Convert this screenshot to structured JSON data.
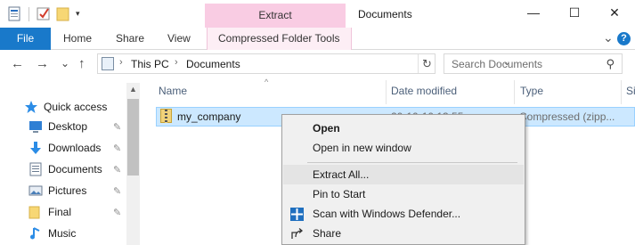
{
  "window": {
    "title": "Documents",
    "context_tab": "Extract",
    "controls": {
      "minimize": "—",
      "maximize": "☐",
      "close": "✕"
    }
  },
  "ribbon": {
    "file": "File",
    "tabs": [
      "Home",
      "Share",
      "View"
    ],
    "context_tab": "Compressed Folder Tools",
    "collapse_glyph": "⌄",
    "help_glyph": "?"
  },
  "nav": {
    "back": "←",
    "forward": "→",
    "recent": "⌄",
    "up": "↑",
    "breadcrumb": [
      "This PC",
      "Documents"
    ],
    "separator": "›",
    "dropdown": "⌄",
    "refresh": "↻",
    "search_placeholder": "Search Documents",
    "search_glyph": "⚲"
  },
  "sidebar": {
    "items": [
      {
        "label": "Quick access",
        "icon": "star-icon",
        "pinned": false
      },
      {
        "label": "Desktop",
        "icon": "desktop-icon",
        "pinned": true
      },
      {
        "label": "Downloads",
        "icon": "download-icon",
        "pinned": true
      },
      {
        "label": "Documents",
        "icon": "document-icon",
        "pinned": true
      },
      {
        "label": "Pictures",
        "icon": "pictures-icon",
        "pinned": true
      },
      {
        "label": "Final",
        "icon": "folder-icon",
        "pinned": true
      },
      {
        "label": "Music",
        "icon": "music-icon",
        "pinned": false
      }
    ],
    "pin_glyph": "📌",
    "scroll_up": "▲"
  },
  "files": {
    "columns": [
      "Name",
      "Date modified",
      "Type",
      "Si"
    ],
    "sort_glyph": "^",
    "rows": [
      {
        "name": "my_company",
        "date": "20-10-10 13:55",
        "type": "Compressed (zipp..."
      }
    ]
  },
  "context_menu": {
    "items": [
      "Open",
      "Open in new window",
      "Extract All...",
      "Pin to Start",
      "Scan with Windows Defender...",
      "Share"
    ]
  },
  "colors": {
    "accent": "#1979ca",
    "context_tab": "#f9cce3",
    "selection": "#cce8ff"
  }
}
